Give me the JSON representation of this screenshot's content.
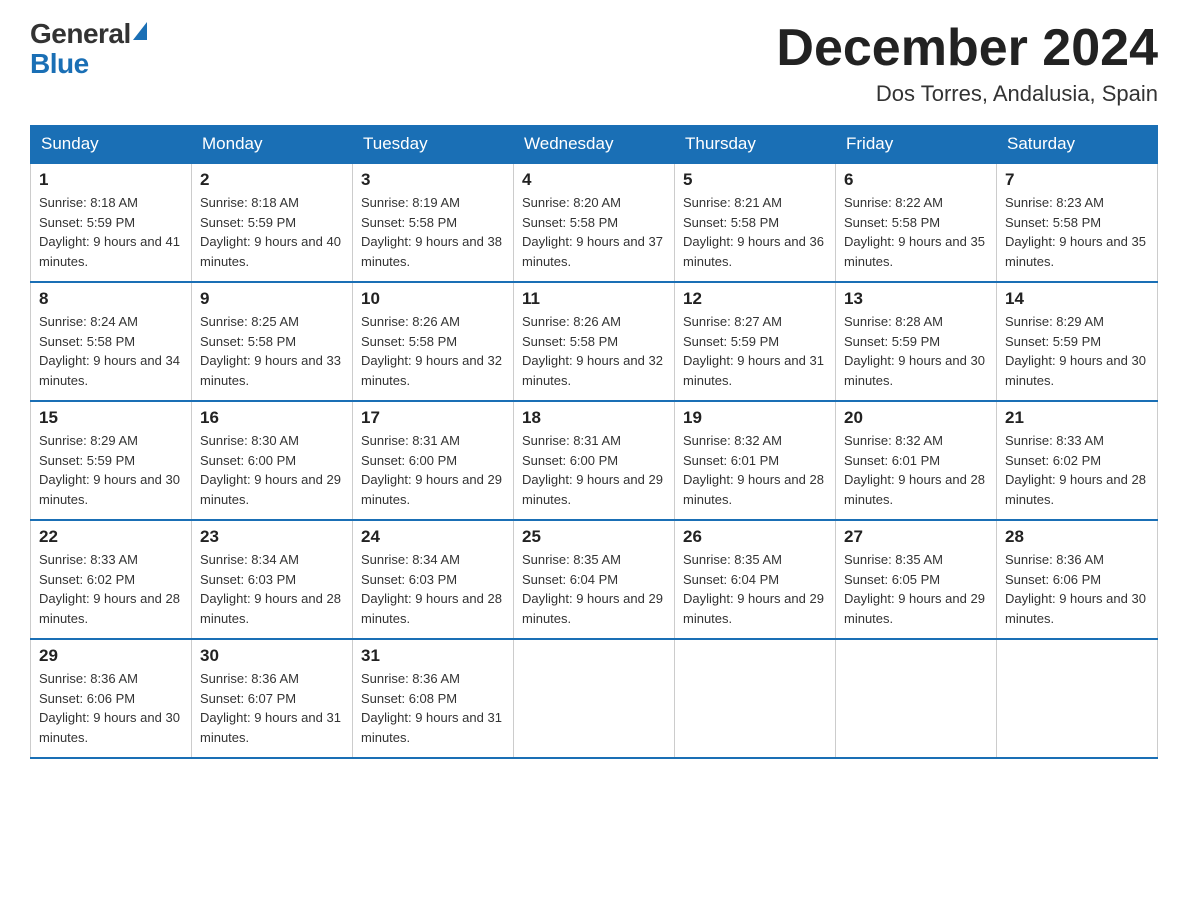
{
  "header": {
    "logo_general": "General",
    "logo_blue": "Blue",
    "month_title": "December 2024",
    "location": "Dos Torres, Andalusia, Spain"
  },
  "days_of_week": [
    "Sunday",
    "Monday",
    "Tuesday",
    "Wednesday",
    "Thursday",
    "Friday",
    "Saturday"
  ],
  "weeks": [
    [
      {
        "day": "1",
        "sunrise": "8:18 AM",
        "sunset": "5:59 PM",
        "daylight": "9 hours and 41 minutes."
      },
      {
        "day": "2",
        "sunrise": "8:18 AM",
        "sunset": "5:59 PM",
        "daylight": "9 hours and 40 minutes."
      },
      {
        "day": "3",
        "sunrise": "8:19 AM",
        "sunset": "5:58 PM",
        "daylight": "9 hours and 38 minutes."
      },
      {
        "day": "4",
        "sunrise": "8:20 AM",
        "sunset": "5:58 PM",
        "daylight": "9 hours and 37 minutes."
      },
      {
        "day": "5",
        "sunrise": "8:21 AM",
        "sunset": "5:58 PM",
        "daylight": "9 hours and 36 minutes."
      },
      {
        "day": "6",
        "sunrise": "8:22 AM",
        "sunset": "5:58 PM",
        "daylight": "9 hours and 35 minutes."
      },
      {
        "day": "7",
        "sunrise": "8:23 AM",
        "sunset": "5:58 PM",
        "daylight": "9 hours and 35 minutes."
      }
    ],
    [
      {
        "day": "8",
        "sunrise": "8:24 AM",
        "sunset": "5:58 PM",
        "daylight": "9 hours and 34 minutes."
      },
      {
        "day": "9",
        "sunrise": "8:25 AM",
        "sunset": "5:58 PM",
        "daylight": "9 hours and 33 minutes."
      },
      {
        "day": "10",
        "sunrise": "8:26 AM",
        "sunset": "5:58 PM",
        "daylight": "9 hours and 32 minutes."
      },
      {
        "day": "11",
        "sunrise": "8:26 AM",
        "sunset": "5:58 PM",
        "daylight": "9 hours and 32 minutes."
      },
      {
        "day": "12",
        "sunrise": "8:27 AM",
        "sunset": "5:59 PM",
        "daylight": "9 hours and 31 minutes."
      },
      {
        "day": "13",
        "sunrise": "8:28 AM",
        "sunset": "5:59 PM",
        "daylight": "9 hours and 30 minutes."
      },
      {
        "day": "14",
        "sunrise": "8:29 AM",
        "sunset": "5:59 PM",
        "daylight": "9 hours and 30 minutes."
      }
    ],
    [
      {
        "day": "15",
        "sunrise": "8:29 AM",
        "sunset": "5:59 PM",
        "daylight": "9 hours and 30 minutes."
      },
      {
        "day": "16",
        "sunrise": "8:30 AM",
        "sunset": "6:00 PM",
        "daylight": "9 hours and 29 minutes."
      },
      {
        "day": "17",
        "sunrise": "8:31 AM",
        "sunset": "6:00 PM",
        "daylight": "9 hours and 29 minutes."
      },
      {
        "day": "18",
        "sunrise": "8:31 AM",
        "sunset": "6:00 PM",
        "daylight": "9 hours and 29 minutes."
      },
      {
        "day": "19",
        "sunrise": "8:32 AM",
        "sunset": "6:01 PM",
        "daylight": "9 hours and 28 minutes."
      },
      {
        "day": "20",
        "sunrise": "8:32 AM",
        "sunset": "6:01 PM",
        "daylight": "9 hours and 28 minutes."
      },
      {
        "day": "21",
        "sunrise": "8:33 AM",
        "sunset": "6:02 PM",
        "daylight": "9 hours and 28 minutes."
      }
    ],
    [
      {
        "day": "22",
        "sunrise": "8:33 AM",
        "sunset": "6:02 PM",
        "daylight": "9 hours and 28 minutes."
      },
      {
        "day": "23",
        "sunrise": "8:34 AM",
        "sunset": "6:03 PM",
        "daylight": "9 hours and 28 minutes."
      },
      {
        "day": "24",
        "sunrise": "8:34 AM",
        "sunset": "6:03 PM",
        "daylight": "9 hours and 28 minutes."
      },
      {
        "day": "25",
        "sunrise": "8:35 AM",
        "sunset": "6:04 PM",
        "daylight": "9 hours and 29 minutes."
      },
      {
        "day": "26",
        "sunrise": "8:35 AM",
        "sunset": "6:04 PM",
        "daylight": "9 hours and 29 minutes."
      },
      {
        "day": "27",
        "sunrise": "8:35 AM",
        "sunset": "6:05 PM",
        "daylight": "9 hours and 29 minutes."
      },
      {
        "day": "28",
        "sunrise": "8:36 AM",
        "sunset": "6:06 PM",
        "daylight": "9 hours and 30 minutes."
      }
    ],
    [
      {
        "day": "29",
        "sunrise": "8:36 AM",
        "sunset": "6:06 PM",
        "daylight": "9 hours and 30 minutes."
      },
      {
        "day": "30",
        "sunrise": "8:36 AM",
        "sunset": "6:07 PM",
        "daylight": "9 hours and 31 minutes."
      },
      {
        "day": "31",
        "sunrise": "8:36 AM",
        "sunset": "6:08 PM",
        "daylight": "9 hours and 31 minutes."
      },
      null,
      null,
      null,
      null
    ]
  ]
}
